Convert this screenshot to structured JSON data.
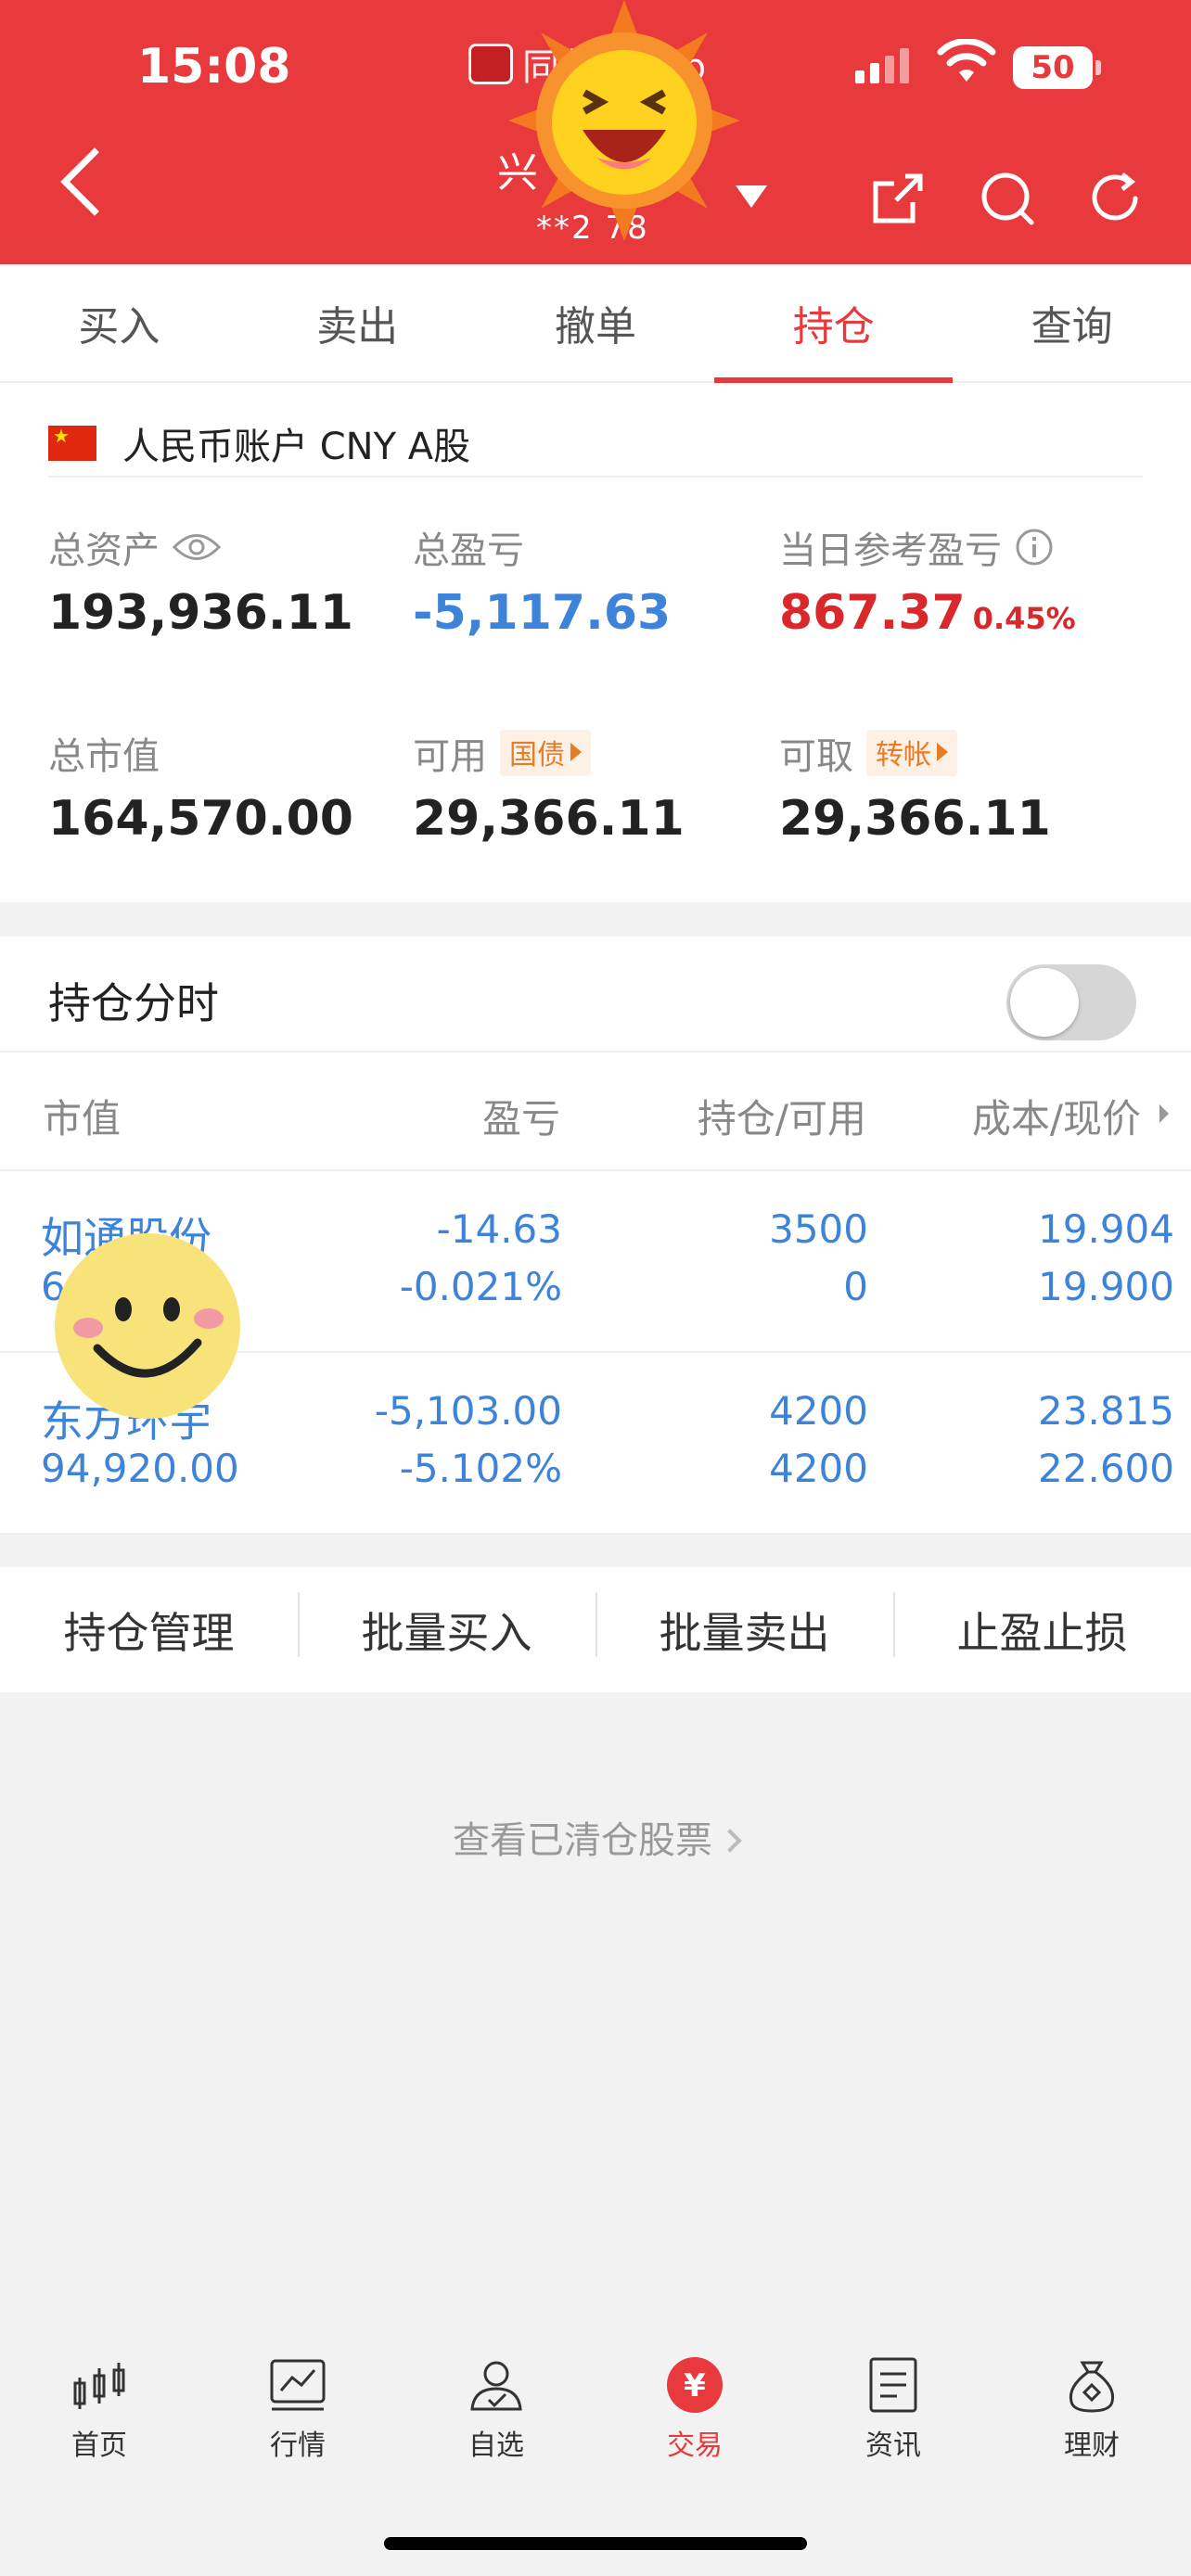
{
  "status_bar": {
    "time": "15:08",
    "app_hint": "同花顺App",
    "battery": "50"
  },
  "nav": {
    "title": "兴",
    "account": "**2 78"
  },
  "tabs": [
    "买入",
    "卖出",
    "撤单",
    "持仓",
    "查询"
  ],
  "active_tab": "持仓",
  "account": {
    "label": "人民币账户 CNY A股"
  },
  "summary": {
    "total_assets_label": "总资产",
    "total_assets": "193,936.11",
    "total_pnl_label": "总盈亏",
    "total_pnl": "-5,117.63",
    "daily_pnl_label": "当日参考盈亏",
    "daily_pnl": "867.37",
    "daily_pnl_pct": "0.45%",
    "market_value_label": "总市值",
    "market_value": "164,570.00",
    "available_label": "可用",
    "available_tag": "国债",
    "available": "29,366.11",
    "withdrawable_label": "可取",
    "withdrawable_tag": "转帐",
    "withdrawable": "29,366.11"
  },
  "position_timeshare": {
    "label": "持仓分时",
    "enabled": false
  },
  "table": {
    "headers": [
      "市值",
      "盈亏",
      "持仓/可用",
      "成本/现价"
    ],
    "rows": [
      {
        "name": "如通股份",
        "market_value": "6",
        "pnl": "-14.63",
        "pnl_pct": "-0.021%",
        "position": "3500",
        "available": "0",
        "cost": "19.904",
        "price": "19.900"
      },
      {
        "name": "东方环宇",
        "market_value": "94,920.00",
        "pnl": "-5,103.00",
        "pnl_pct": "-5.102%",
        "position": "4200",
        "available": "4200",
        "cost": "23.815",
        "price": "22.600"
      }
    ]
  },
  "actions": [
    "持仓管理",
    "批量买入",
    "批量卖出",
    "止盈止损"
  ],
  "cleared_link": "查看已清仓股票",
  "bottom_nav": [
    "首页",
    "行情",
    "自选",
    "交易",
    "资讯",
    "理财"
  ],
  "colors": {
    "brand_red": "#e8393d",
    "blue": "#3d83d9",
    "orange": "#e87b24"
  }
}
